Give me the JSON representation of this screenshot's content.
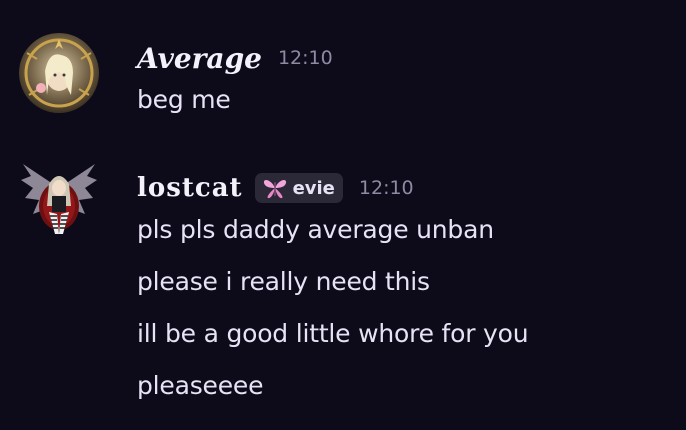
{
  "messages": [
    {
      "author": "Average",
      "time": "12:10",
      "lines": [
        "beg me"
      ]
    },
    {
      "author": "lostcat",
      "tag": "evie",
      "time": "12:10",
      "lines": [
        "pls pls daddy average unban",
        "please i really need this",
        "ill be a good little whore for you",
        "pleaseeee"
      ]
    }
  ],
  "icons": {
    "tag": "butterfly-icon"
  },
  "colors": {
    "background": "#0d0b1a",
    "text": "#e7e2f5",
    "timestamp": "#8e8aa3",
    "tag_background": "#2b2838",
    "tag_icon": "#f0a6d8"
  }
}
